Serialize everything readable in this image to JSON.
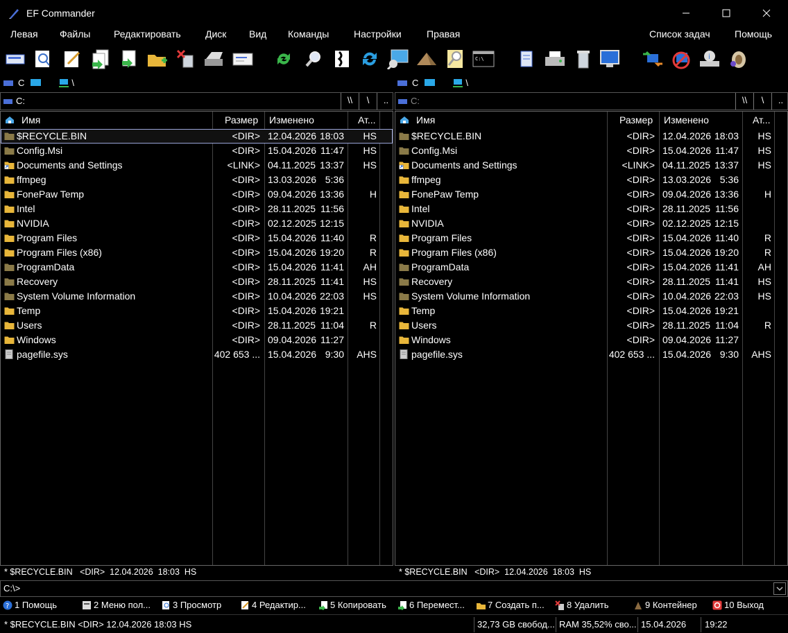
{
  "window": {
    "title": "EF Commander"
  },
  "menu": [
    "Левая",
    "Файлы",
    "Редактировать",
    "Диск",
    "Вид",
    "Команды",
    "Настройки",
    "Правая",
    "Список задач",
    "Помощь"
  ],
  "drive_bar": {
    "drive": "C",
    "path": "\\"
  },
  "left": {
    "path": "C:",
    "nav_buttons": [
      "\\\\",
      "\\",
      ".."
    ],
    "columns": {
      "name": "Имя",
      "size": "Размер",
      "date": "Изменено",
      "attr": "Ат..."
    },
    "status": "* $RECYCLE.BIN   <DIR>  12.04.2026  18:03  HS"
  },
  "right": {
    "path": "C:",
    "nav_buttons": [
      "\\\\",
      "\\",
      ".."
    ],
    "columns": {
      "name": "Имя",
      "size": "Размер",
      "date": "Изменено",
      "attr": "Ат..."
    },
    "status": "* $RECYCLE.BIN   <DIR>  12.04.2026  18:03  HS"
  },
  "files": [
    {
      "name": "$RECYCLE.BIN",
      "size": "<DIR>",
      "date": "12.04.2026",
      "time": "18:03",
      "attr": "HS",
      "icon": "folder-hidden"
    },
    {
      "name": "Config.Msi",
      "size": "<DIR>",
      "date": "15.04.2026",
      "time": "11:47",
      "attr": "HS",
      "icon": "folder-hidden"
    },
    {
      "name": "Documents and Settings",
      "size": "<LINK>",
      "date": "04.11.2025",
      "time": "13:37",
      "attr": "HS",
      "icon": "folder-link"
    },
    {
      "name": "ffmpeg",
      "size": "<DIR>",
      "date": "13.03.2026",
      "time": "5:36",
      "attr": "",
      "icon": "folder"
    },
    {
      "name": "FonePaw Temp",
      "size": "<DIR>",
      "date": "09.04.2026",
      "time": "13:36",
      "attr": "H",
      "icon": "folder"
    },
    {
      "name": "Intel",
      "size": "<DIR>",
      "date": "28.11.2025",
      "time": "11:56",
      "attr": "",
      "icon": "folder"
    },
    {
      "name": "NVIDIA",
      "size": "<DIR>",
      "date": "02.12.2025",
      "time": "12:15",
      "attr": "",
      "icon": "folder"
    },
    {
      "name": "Program Files",
      "size": "<DIR>",
      "date": "15.04.2026",
      "time": "11:40",
      "attr": "R",
      "icon": "folder"
    },
    {
      "name": "Program Files (x86)",
      "size": "<DIR>",
      "date": "15.04.2026",
      "time": "19:20",
      "attr": "R",
      "icon": "folder"
    },
    {
      "name": "ProgramData",
      "size": "<DIR>",
      "date": "15.04.2026",
      "time": "11:41",
      "attr": "AH",
      "icon": "folder-hidden"
    },
    {
      "name": "Recovery",
      "size": "<DIR>",
      "date": "28.11.2025",
      "time": "11:41",
      "attr": "HS",
      "icon": "folder-hidden"
    },
    {
      "name": "System Volume Information",
      "size": "<DIR>",
      "date": "10.04.2026",
      "time": "22:03",
      "attr": "HS",
      "icon": "folder-hidden"
    },
    {
      "name": "Temp",
      "size": "<DIR>",
      "date": "15.04.2026",
      "time": "19:21",
      "attr": "",
      "icon": "folder"
    },
    {
      "name": "Users",
      "size": "<DIR>",
      "date": "28.11.2025",
      "time": "11:04",
      "attr": "R",
      "icon": "folder"
    },
    {
      "name": "Windows",
      "size": "<DIR>",
      "date": "09.04.2026",
      "time": "11:27",
      "attr": "",
      "icon": "folder"
    },
    {
      "name": "pagefile.sys",
      "size": "402 653 ...",
      "date": "15.04.2026",
      "time": "9:30",
      "attr": "AHS",
      "icon": "file"
    }
  ],
  "command_line": "C:\\>",
  "fkeys": [
    "1 Помощь",
    "2 Меню пол...",
    "3 Просмотр",
    "4 Редактир...",
    "5 Копировать",
    "6 Перемест...",
    "7 Создать п...",
    "8 Удалить",
    "9 Контейнер",
    "10 Выход"
  ],
  "bottom": {
    "selection": "* $RECYCLE.BIN   <DIR>  12.04.2026  18:03  HS",
    "free_space": "32,73 GB свобод...",
    "ram": "RAM 35,52% сво...",
    "date": "15.04.2026",
    "time": "19:22"
  },
  "colors": {
    "folder": "#e8b63a",
    "folder_hidden": "#8a7a48",
    "selection_outline": "#9aa4d8"
  }
}
